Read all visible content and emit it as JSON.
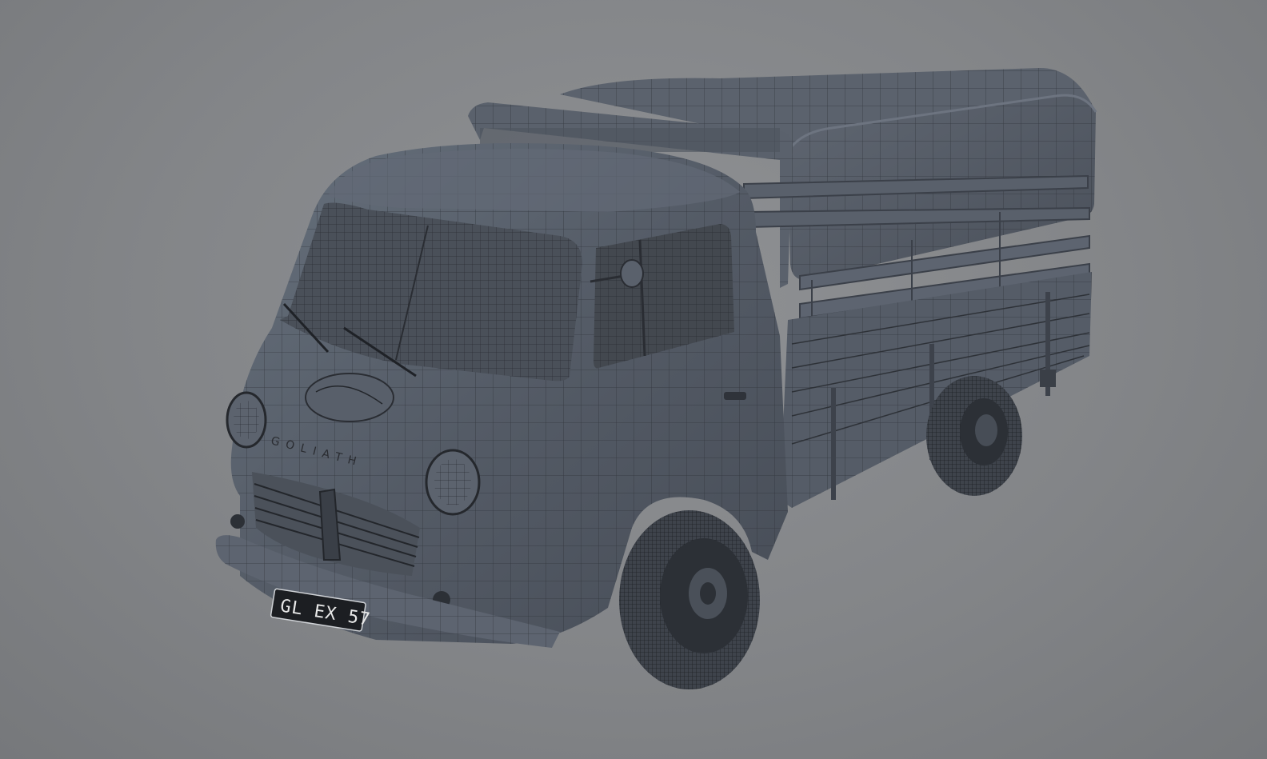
{
  "scene": {
    "background_color": "#86888b",
    "model_color": "#4f5560",
    "wire_color": "#2b2e34",
    "highlight_color": "#6a717c"
  },
  "vehicle": {
    "brand_lettering": "GOLIATH",
    "license_plate": "GL EX 57"
  }
}
